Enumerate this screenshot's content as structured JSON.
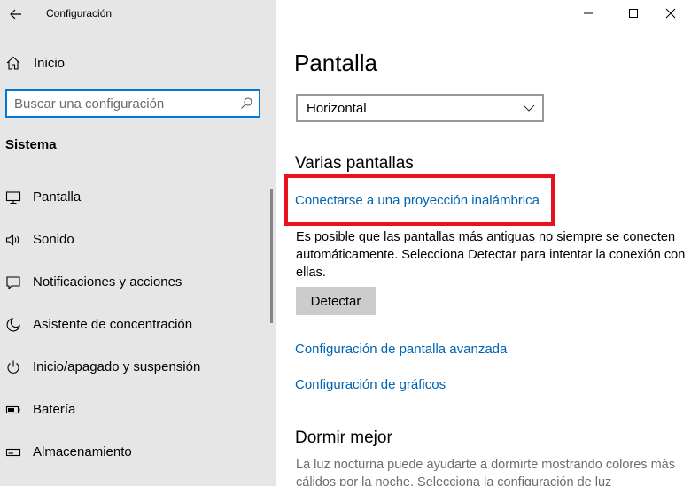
{
  "window": {
    "title": "Configuración"
  },
  "sidebar": {
    "home_label": "Inicio",
    "search_placeholder": "Buscar una configuración",
    "section_title": "Sistema",
    "items": [
      {
        "label": "Pantalla",
        "icon": "monitor-icon"
      },
      {
        "label": "Sonido",
        "icon": "speaker-icon"
      },
      {
        "label": "Notificaciones y acciones",
        "icon": "notification-icon"
      },
      {
        "label": "Asistente de concentración",
        "icon": "moon-icon"
      },
      {
        "label": "Inicio/apagado y suspensión",
        "icon": "power-icon"
      },
      {
        "label": "Batería",
        "icon": "battery-icon"
      },
      {
        "label": "Almacenamiento",
        "icon": "storage-icon"
      }
    ]
  },
  "main": {
    "page_title": "Pantalla",
    "orientation_value": "Horizontal",
    "multi_display": {
      "heading": "Varias pantallas",
      "wireless_link": "Conectarse a una proyección inalámbrica",
      "description": "Es posible que las pantallas más antiguas no siempre se conecten automáticamente. Selecciona Detectar para intentar la conexión con ellas.",
      "detect_label": "Detectar"
    },
    "advanced_link": "Configuración de pantalla avanzada",
    "graphics_link": "Configuración de gráficos",
    "sleep": {
      "heading": "Dormir mejor",
      "description": "La luz nocturna puede ayudarte a dormirte mostrando colores más cálidos por la noche. Selecciona la configuración de luz"
    }
  },
  "colors": {
    "accent": "#0078d7",
    "link": "#0063b1",
    "highlight": "#e81123",
    "sidebar_bg": "#e6e6e6"
  }
}
